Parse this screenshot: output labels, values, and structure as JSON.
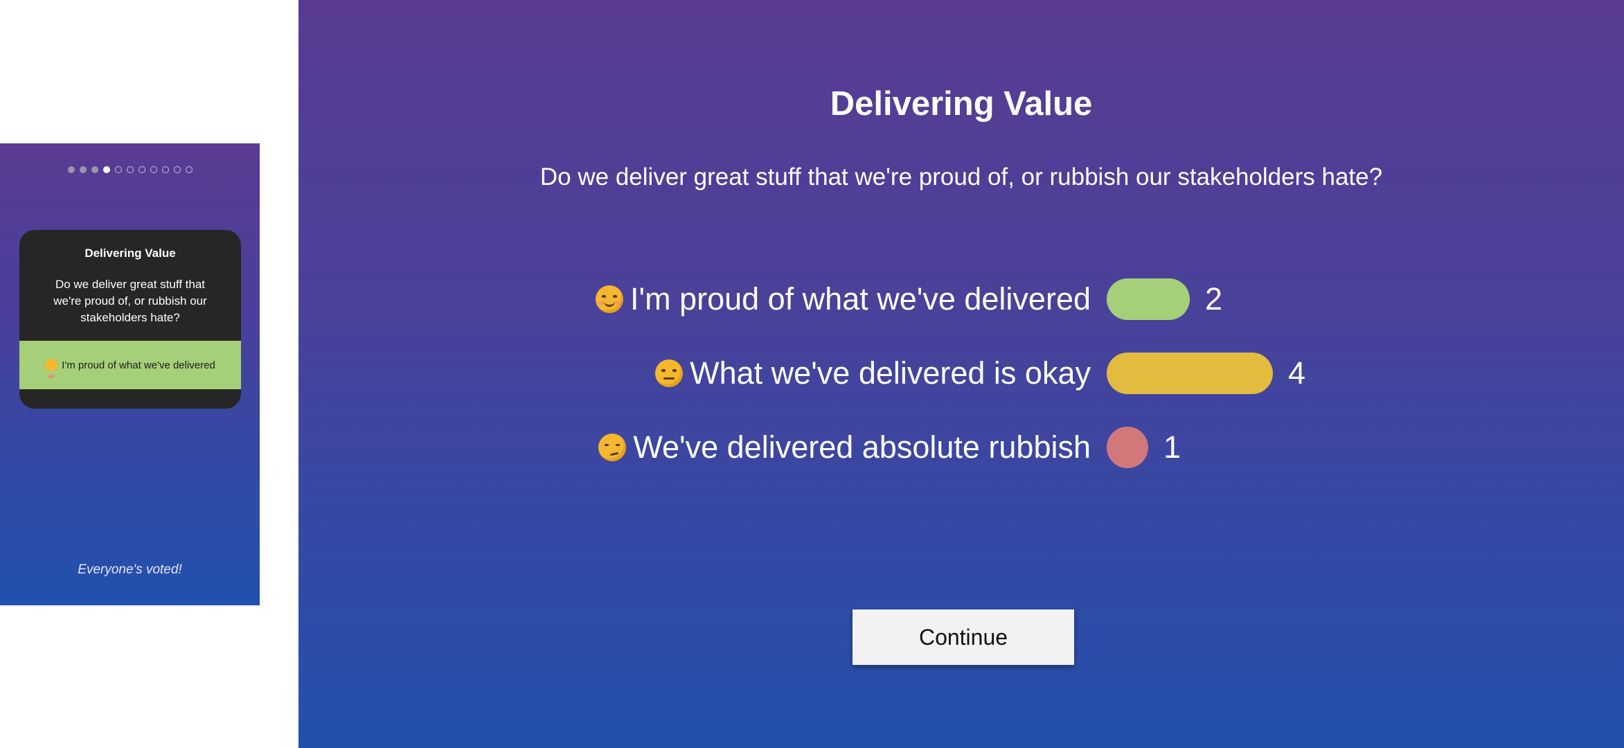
{
  "phone": {
    "progress": {
      "total": 11,
      "completed": 3,
      "current_index": 3
    },
    "card": {
      "title": "Delivering Value",
      "question": "Do we deliver great stuff that we're proud of, or rubbish our stakeholders hate?",
      "selected_answer": "I'm proud of what we've delivered",
      "selected_emoji": "smiling-face-icon",
      "selected_color": "#a5cf78"
    },
    "footer": "Everyone's voted!"
  },
  "results": {
    "title": "Delivering Value",
    "question": "Do we deliver great stuff that we're proud of, or rubbish our stakeholders hate?",
    "max_count": 4,
    "options": [
      {
        "emoji": "smiling-face-icon",
        "label": "I'm proud of what we've delivered",
        "count": 2,
        "color": "#a5cf78"
      },
      {
        "emoji": "neutral-face-icon",
        "label": "What we've delivered is okay",
        "count": 4,
        "color": "#e2bb3f"
      },
      {
        "emoji": "unamused-face-icon",
        "label": "We've delivered absolute rubbish",
        "count": 1,
        "color": "#d1797a"
      }
    ],
    "continue_label": "Continue"
  }
}
